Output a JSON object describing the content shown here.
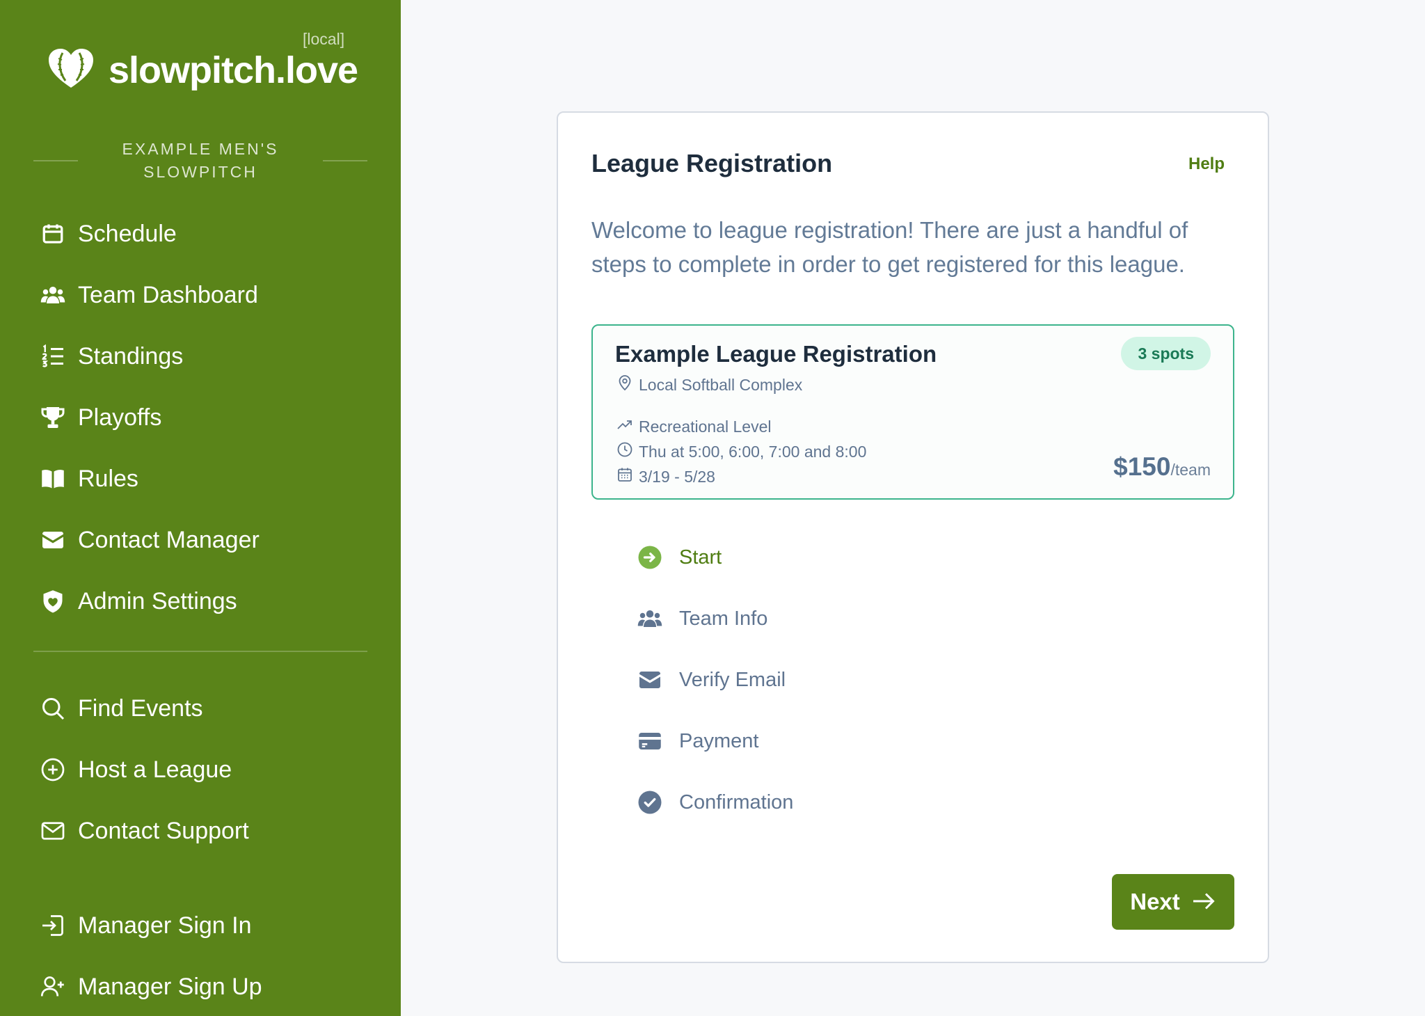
{
  "brand": {
    "env_tag": "[local]",
    "logo_text": "slowpitch.love",
    "logo_icon": "heart-softball-icon"
  },
  "org": {
    "name": "EXAMPLE MEN'S SLOWPITCH"
  },
  "nav": {
    "primary": [
      {
        "label": "Schedule",
        "icon": "calendar-icon"
      },
      {
        "label": "Team Dashboard",
        "icon": "users-icon"
      },
      {
        "label": "Standings",
        "icon": "list-ordered-icon"
      },
      {
        "label": "Playoffs",
        "icon": "trophy-icon"
      },
      {
        "label": "Rules",
        "icon": "book-icon"
      },
      {
        "label": "Contact Manager",
        "icon": "envelope-icon"
      },
      {
        "label": "Admin Settings",
        "icon": "shield-heart-icon"
      }
    ],
    "secondary": [
      {
        "label": "Find Events",
        "icon": "search-icon"
      },
      {
        "label": "Host a League",
        "icon": "plus-circle-icon"
      },
      {
        "label": "Contact Support",
        "icon": "mail-outline-icon"
      }
    ],
    "account": [
      {
        "label": "Manager Sign In",
        "icon": "sign-in-icon"
      },
      {
        "label": "Manager Sign Up",
        "icon": "user-plus-icon"
      }
    ]
  },
  "registration": {
    "title": "League Registration",
    "help_label": "Help",
    "intro": "Welcome to league registration! There are just a handful of steps to complete in order to get registered for this league."
  },
  "league": {
    "name": "Example League Registration",
    "spots": "3 spots",
    "location": "Local Softball Complex",
    "level": "Recreational Level",
    "times": "Thu at 5:00, 6:00, 7:00 and 8:00",
    "dates": "3/19 - 5/28",
    "price": "$150",
    "price_unit": "/team",
    "accent_color": "#3cb48c"
  },
  "steps": [
    {
      "label": "Start",
      "icon": "arrow-circle-icon",
      "active": true
    },
    {
      "label": "Team Info",
      "icon": "users-icon",
      "active": false
    },
    {
      "label": "Verify Email",
      "icon": "envelope-icon",
      "active": false
    },
    {
      "label": "Payment",
      "icon": "credit-card-icon",
      "active": false
    },
    {
      "label": "Confirmation",
      "icon": "check-circle-icon",
      "active": false
    }
  ],
  "actions": {
    "next_label": "Next"
  },
  "colors": {
    "sidebar": "#5a8419",
    "primary_green": "#4f7d12",
    "step_inactive": "#5f7490"
  }
}
